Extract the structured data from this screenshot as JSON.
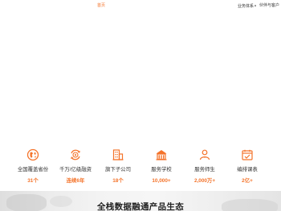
{
  "nav": {
    "home": "首页",
    "business": "业务体系",
    "business_caret": "▾",
    "partner": "伙伴与客户"
  },
  "stats": [
    {
      "icon": "globe-icon",
      "label": "全国覆盖省份",
      "value": "31个"
    },
    {
      "icon": "finance-cycle-icon",
      "label": "千万/亿级融资",
      "value": "连续6年"
    },
    {
      "icon": "building-icon",
      "label": "旗下子公司",
      "value": "18个"
    },
    {
      "icon": "school-icon",
      "label": "服务学校",
      "value": "10,000+"
    },
    {
      "icon": "teacher-student-icon",
      "label": "服务师生",
      "value": "2,000万+"
    },
    {
      "icon": "course-calendar-icon",
      "label": "编排课表",
      "value": "2亿+"
    }
  ],
  "banner": {
    "title": "全栈数据融通产品生态"
  },
  "colors": {
    "accent": "#f4732a",
    "text": "#333333"
  }
}
